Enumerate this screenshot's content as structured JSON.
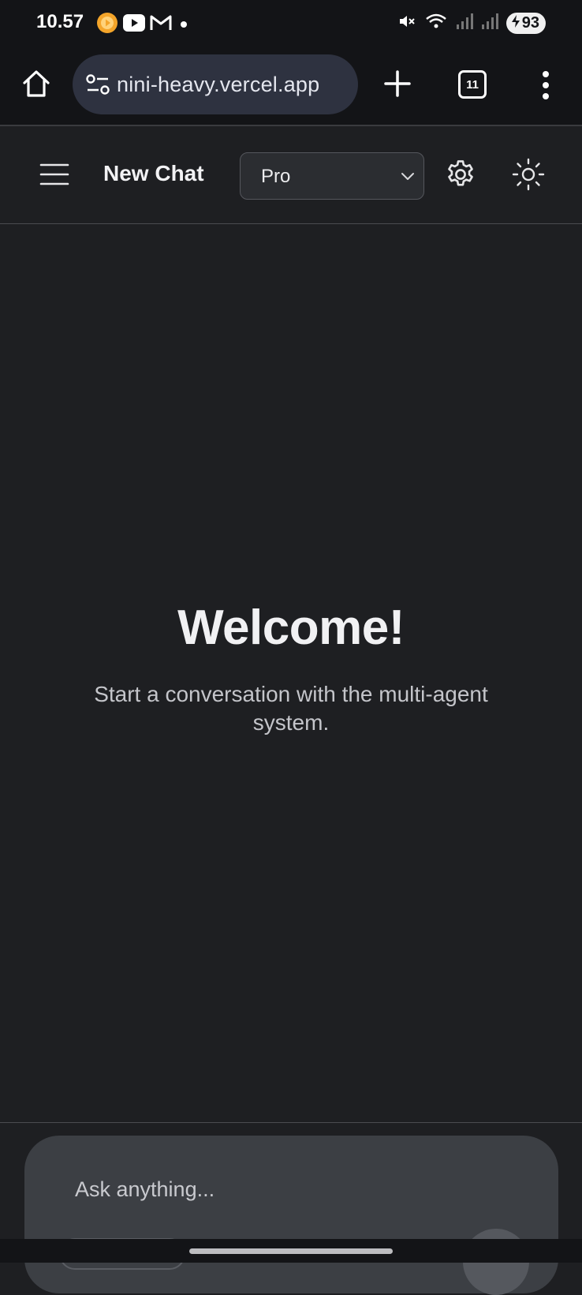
{
  "status_bar": {
    "time": "10.57",
    "battery": "93",
    "notification_icons": [
      "music-app-icon",
      "youtube-icon",
      "gmail-icon",
      "dot-icon"
    ],
    "system_icons": [
      "mute-icon",
      "wifi-icon",
      "signal-icon",
      "signal-icon",
      "battery-icon"
    ]
  },
  "browser": {
    "url": "nini-heavy.vercel.app",
    "tab_count": "11"
  },
  "header": {
    "title": "New Chat",
    "model_selected": "Pro"
  },
  "main": {
    "welcome_title": "Welcome!",
    "welcome_subtitle": "Start a conversation with the multi-agent system."
  },
  "composer": {
    "placeholder": "Ask anything..."
  },
  "colors": {
    "background": "#1e1f22",
    "status_bar": "#131417",
    "url_pill": "#2e3240",
    "composer": "#3c3f44"
  }
}
